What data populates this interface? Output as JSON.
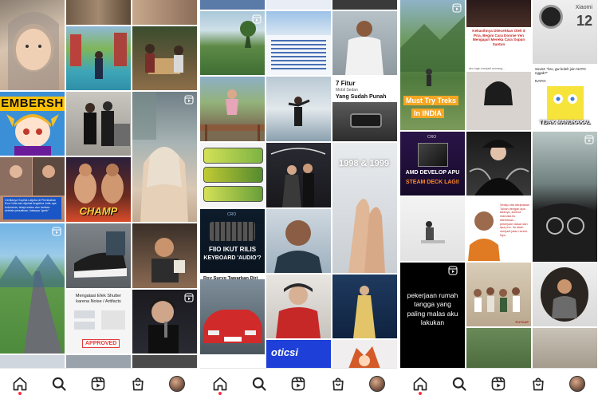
{
  "screens": [
    {
      "id": "left",
      "tiles": {
        "embership_text": "EMBERSH",
        "news_caption": "Cerlitanya Sophia Latjuba di Pernikahan Eva Celia dan dijuluki Angelina Jolie-nya Indonesia, tetapi walau dan bahkan setelah persalinan, katanya \"geek\"",
        "champ_text": "CHAMP",
        "noise_title": "Mengatasi Efek Shutter karena Noise / Artifacts",
        "approved_text": "APPROVED"
      }
    },
    {
      "id": "middle",
      "tiles": {
        "borobudur_title": "Roy Suryo Tawarkan Diri Bantu Polisi Cari Pengunggah Meme Candi Borobudur",
        "fiio_line1": "FIIO IKUT RILIS",
        "fiio_line2": "KEYBOARD 'AUDIO'?",
        "fitur_title": "7 Fitur",
        "fitur_sub": "Mobil Sedan",
        "fitur_line": "Yang Sudah Punah",
        "year_text": "1998 & 1999",
        "cro_label": "CRO",
        "detik_text": "oticsi"
      }
    },
    {
      "id": "right",
      "tiles": {
        "treks_line1": "Must Try Treks",
        "treks_line2": "In INDIA",
        "kekasih_text": "Kekasihnya Dilecehkan Oleh 8 Pria, Begini Cara Donnie Yen Mengajari Mereka Cara Sopan Santun",
        "soviet_text": "Soviet: \"bro, gw boleh join NATO nggak?\"",
        "nato_text": "NATO:",
        "tidak_text": "TIDAK MANUKAKAL",
        "xiaomi_text": "Xiaomi",
        "xiaomi_num": "12",
        "amd_line1": "AMD DEVELOP APU",
        "amd_line2": "STEAM DECK LAGI!",
        "cro_label": "CRO",
        "pekerjaan_text": "pekerjaan rumah tangga yang paling malas aku lakukan",
        "setiap_text": "Setiap kita ditciptakan Tuhan dengan apa adanya, karena manusia itu dilebihkan... pekerjaan dasar dan apa pun. Itu akan menjadi jalan rezeki-Nya",
        "putcap_text": "PUTCAP"
      }
    }
  ],
  "nav": {
    "icons": [
      "home-icon",
      "search-icon",
      "reels-icon",
      "shop-icon",
      "profile-avatar"
    ]
  },
  "colors": {
    "accent_red": "#ff3040",
    "nav_bg": "#ffffff",
    "nav_icon": "#262626"
  }
}
